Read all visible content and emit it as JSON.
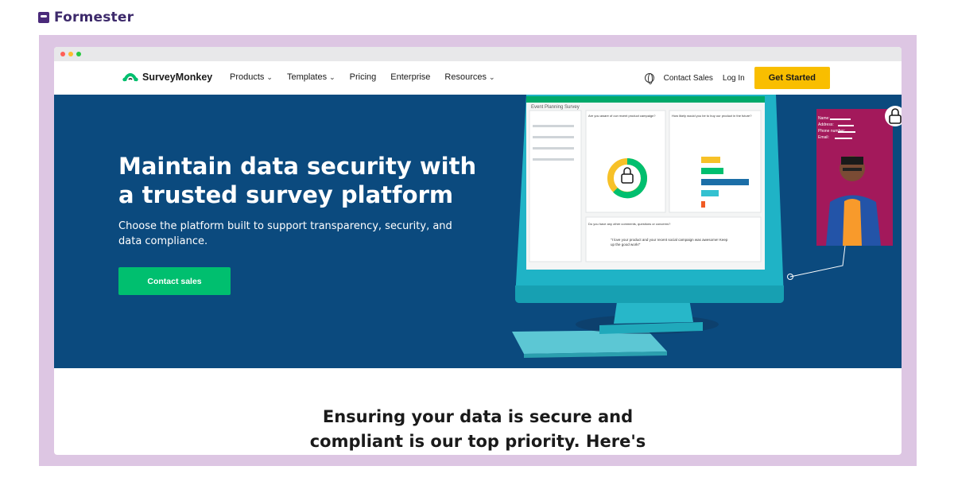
{
  "brand": {
    "name": "Formester"
  },
  "site": {
    "logo_text": "SurveyMonkey",
    "nav": [
      {
        "label": "Products",
        "has_menu": true
      },
      {
        "label": "Templates",
        "has_menu": true
      },
      {
        "label": "Pricing",
        "has_menu": false
      },
      {
        "label": "Enterprise",
        "has_menu": false
      },
      {
        "label": "Resources",
        "has_menu": true
      }
    ],
    "contact_sales": "Contact Sales",
    "login": "Log In",
    "get_started": "Get Started"
  },
  "hero": {
    "title": "Maintain data security with a trusted survey platform",
    "subtitle": "Choose the platform built to support transparency, security, and data compliance.",
    "cta": "Contact sales"
  },
  "illustration": {
    "window_title": "Event Planning Survey",
    "question1": "Are you aware of our recent product campaign?",
    "question2": "How likely would you be to buy our product in the future?",
    "comment_question": "Do you have any other comments, questions or concerns?",
    "quote": "\"I love your product and your recent social campaign was awesome! Keep up the good work!\"",
    "profile_labels": [
      "Name:",
      "Address:",
      "Phone number:",
      "Email:"
    ]
  },
  "section": {
    "title_line1": "Ensuring your data is secure and",
    "title_line2": "compliant is our top priority. Here's"
  },
  "colors": {
    "frame": "#ddc6e3",
    "hero_bg": "#0b4a7e",
    "cta_green": "#00bf6f",
    "cta_yellow": "#f9be00",
    "monitor": "#1fb3c6",
    "profile_card": "#a3195b"
  }
}
